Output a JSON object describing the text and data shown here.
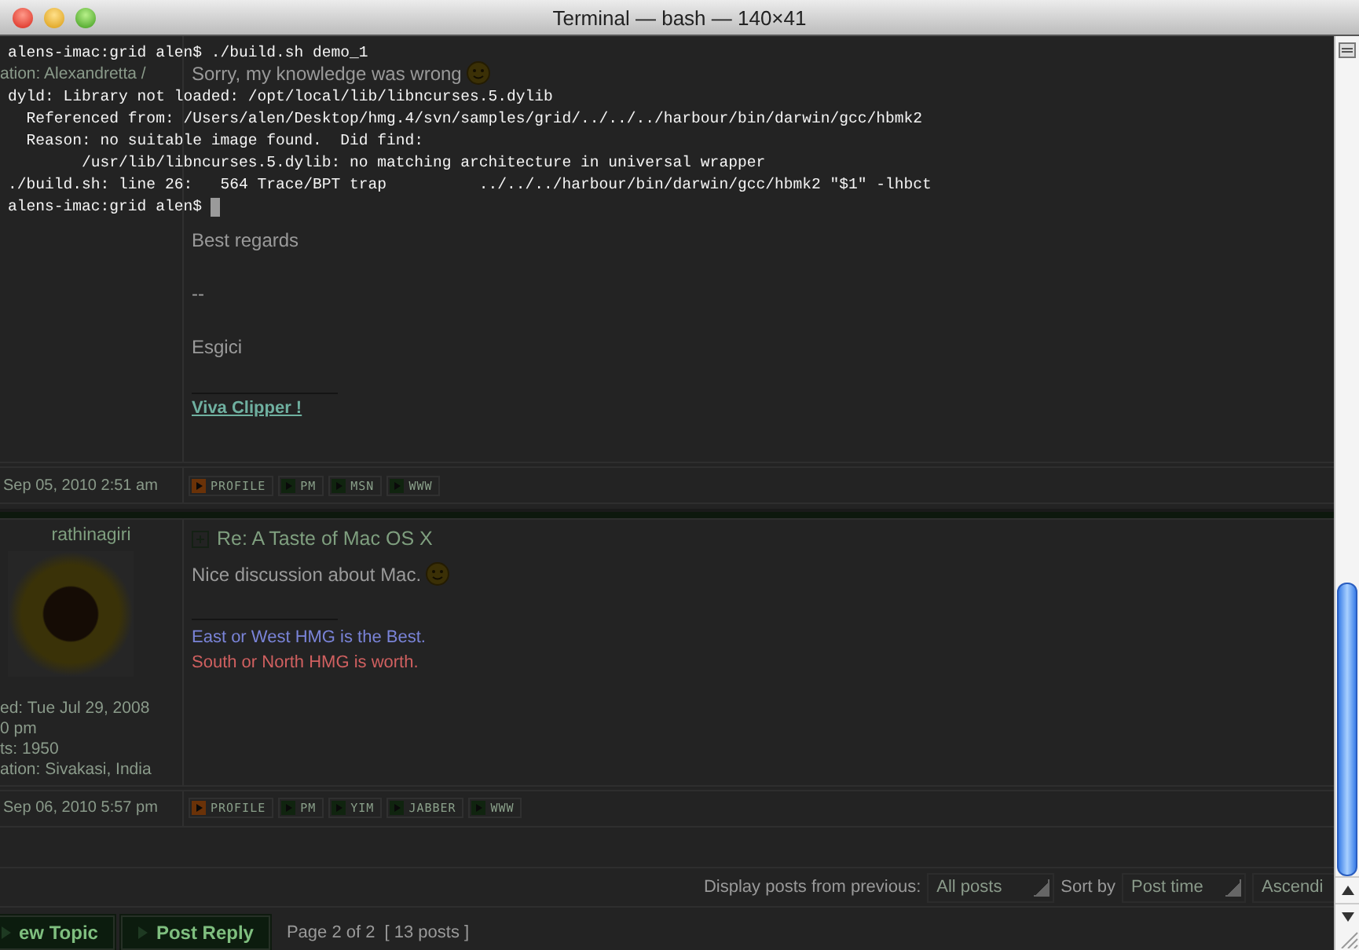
{
  "window": {
    "title": "Terminal — bash — 140×41"
  },
  "terminal": {
    "lines": [
      "alens-imac:grid alen$ ./build.sh demo_1",
      "dyld: Library not loaded: /opt/local/lib/libncurses.5.dylib",
      "  Referenced from: /Users/alen/Desktop/hmg.4/svn/samples/grid/../../../harbour/bin/darwin/gcc/hbmk2",
      "  Reason: no suitable image found.  Did find:",
      "        /usr/lib/libncurses.5.dylib: no matching architecture in universal wrapper",
      "./build.sh: line 26:   564 Trace/BPT trap          ../../../harbour/bin/darwin/gcc/hbmk2 \"$1\" -lhbct",
      "alens-imac:grid alen$ "
    ]
  },
  "forum": {
    "posts": [
      {
        "profile_lines": [
          "ation: Alexandretta /"
        ],
        "body": [
          {
            "text": "Sorry, my knowledge was wrong",
            "emoticon": true
          },
          {
            "text": "Best regards",
            "emoticon": false
          },
          {
            "text": "--",
            "emoticon": false
          },
          {
            "text": "Esgici",
            "emoticon": false
          }
        ],
        "signature": [
          {
            "kind": "link",
            "text": "Viva Clipper !"
          }
        ],
        "date": "Sep 05, 2010 2:51 am",
        "buttons": [
          {
            "label": "PROFILE",
            "color": "#6a3208"
          },
          {
            "label": "PM",
            "color": "#10240f"
          },
          {
            "label": "MSN",
            "color": "#10240f"
          },
          {
            "label": "WWW",
            "color": "#10240f"
          }
        ]
      },
      {
        "author": "rathinagiri",
        "profile_lines": [
          "ed: Tue Jul 29, 2008",
          "0 pm",
          "ts: 1950",
          "ation: Sivakasi, India"
        ],
        "subject": "Re: A Taste of Mac OS X",
        "body": [
          {
            "text": "Nice discussion about Mac.",
            "emoticon": true
          }
        ],
        "signature": [
          {
            "kind": "text",
            "text": "East or West HMG is the Best.",
            "color": "#7a84d8"
          },
          {
            "kind": "text",
            "text": "South or North HMG is worth.",
            "color": "#d06060"
          }
        ],
        "date": "Sep 06, 2010 5:57 pm",
        "buttons": [
          {
            "label": "PROFILE",
            "color": "#6a3208"
          },
          {
            "label": "PM",
            "color": "#10240f"
          },
          {
            "label": "YIM",
            "color": "#10240f"
          },
          {
            "label": "JABBER",
            "color": "#10240f"
          },
          {
            "label": "WWW",
            "color": "#10240f"
          }
        ]
      }
    ],
    "filter": {
      "label": "Display posts from previous:",
      "value": "All posts"
    },
    "sort": {
      "label": "Sort by",
      "value": "Post time"
    },
    "order": {
      "value": "Ascendi"
    },
    "actions": [
      "ew Topic",
      "Post Reply"
    ],
    "pagination": "Page 2 of 2",
    "post_count": "[ 13 posts ]"
  }
}
